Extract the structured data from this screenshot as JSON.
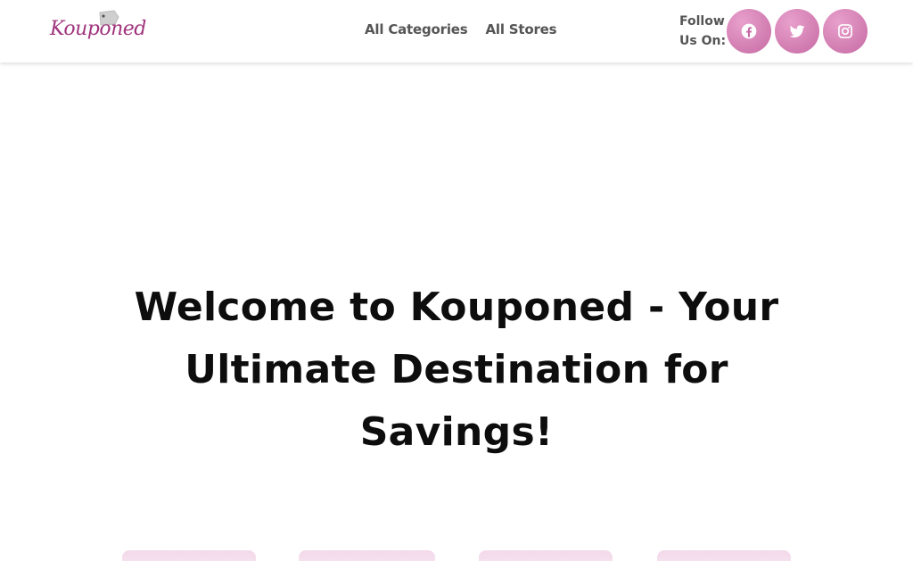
{
  "header": {
    "logo_text": "Kouponed",
    "nav": [
      {
        "label": "All Categories"
      },
      {
        "label": "All Stores"
      }
    ],
    "follow_label": "Follow Us On:",
    "social": [
      {
        "name": "facebook-icon"
      },
      {
        "name": "twitter-icon"
      },
      {
        "name": "instagram-icon"
      }
    ]
  },
  "hero": {
    "title": "Welcome to Kouponed - Your Ultimate Destination for Savings!"
  },
  "colors": {
    "brand": "#a0347c",
    "social_bg": "#c66aa3",
    "card_bg": "#f3d9ea"
  }
}
